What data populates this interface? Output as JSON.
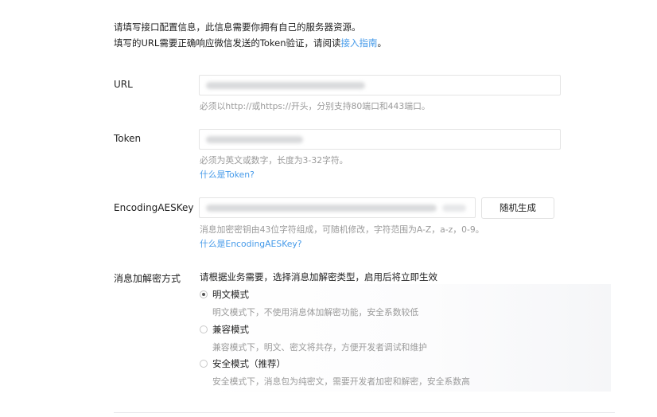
{
  "intro": {
    "line1": "请填写接口配置信息，此信息需要你拥有自己的服务器资源。",
    "line2_prefix": "填写的URL需要正确响应微信发送的Token验证，请阅读",
    "line2_link": "接入指南",
    "line2_suffix": "。"
  },
  "url": {
    "label": "URL",
    "hint": "必须以http://或https://开头，分别支持80端口和443端口。"
  },
  "token": {
    "label": "Token",
    "hint": "必须为英文或数字，长度为3-32字符。",
    "help_link": "什么是Token?"
  },
  "aeskey": {
    "label": "EncodingAESKey",
    "generate_button": "随机生成",
    "hint": "消息加密密钥由43位字符组成，可随机修改，字符范围为A-Z，a-z，0-9。",
    "help_link": "什么是EncodingAESKey?"
  },
  "encryption": {
    "label": "消息加解密方式",
    "description": "请根据业务需要，选择消息加解密类型，启用后将立即生效",
    "options": [
      {
        "label": "明文模式",
        "desc": "明文模式下，不使用消息体加解密功能，安全系数较低",
        "selected": true
      },
      {
        "label": "兼容模式",
        "desc": "兼容模式下，明文、密文将共存，方便开发者调试和维护",
        "selected": false
      },
      {
        "label": "安全模式（推荐）",
        "desc": "安全模式下，消息包为纯密文，需要开发者加密和解密，安全系数高",
        "selected": false
      }
    ]
  }
}
